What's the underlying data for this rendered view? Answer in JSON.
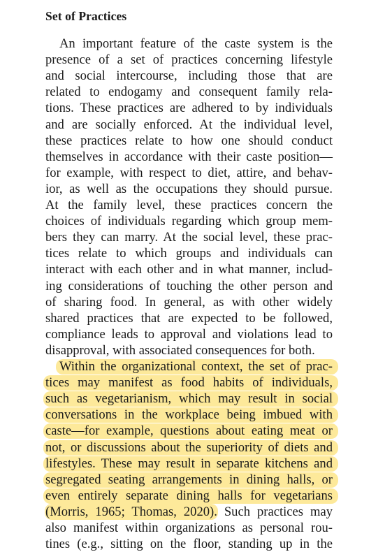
{
  "section": {
    "heading": "Set of Practices",
    "paragraphs": [
      {
        "highlighted": false,
        "lines": [
          "An important feature of the caste system is the",
          "presence of a set of practices concerning lifestyle",
          "and social intercourse, including those that are",
          "related to endogamy and consequent family rela-",
          "tions. These practices are adhered to by individuals",
          "and are socially enforced. At the individual level,",
          "these practices relate to how one should conduct",
          "themselves in accordance with their caste position—",
          "for example, with respect to diet, attire, and behav-",
          "ior, as well as the occupations they should pursue.",
          "At the family level, these practices concern the",
          "choices of individuals regarding which group mem-",
          "bers they can marry. At the social level, these prac-",
          "tices relate to which groups and individuals can",
          "interact with each other and in what manner, includ-",
          "ing considerations of touching the other person and",
          "of sharing food. In general, as with other widely",
          "shared practices that are expected to be followed,",
          "compliance leads to approval and violations lead to",
          "disapproval, with associated consequences for both."
        ]
      },
      {
        "highlighted": true,
        "lines": [
          "Within the organizational context, the set of prac-",
          "tices may manifest as food habits of individuals,",
          "such as vegetarianism, which may result in social",
          "conversations in the workplace being imbued with",
          "caste—for example, questions about eating meat or",
          "not, or discussions about the superiority of diets and",
          "lifestyles. These may result in separate kitchens and",
          "segregated seating arrangements in dining halls, or",
          "even entirely separate dining halls for vegetarians"
        ],
        "mixed_line": {
          "highlighted_part": "(Morris, 1965; Thomas, 2020).",
          "plain_part": " Such practices may"
        },
        "trailing_lines": [
          "also manifest within organizations as personal rou-",
          "tines (e.g., sitting on the floor, standing up in the"
        ]
      }
    ]
  },
  "colors": {
    "highlight": "#fde99a",
    "text": "#1a1a1a",
    "background": "#ffffff"
  }
}
